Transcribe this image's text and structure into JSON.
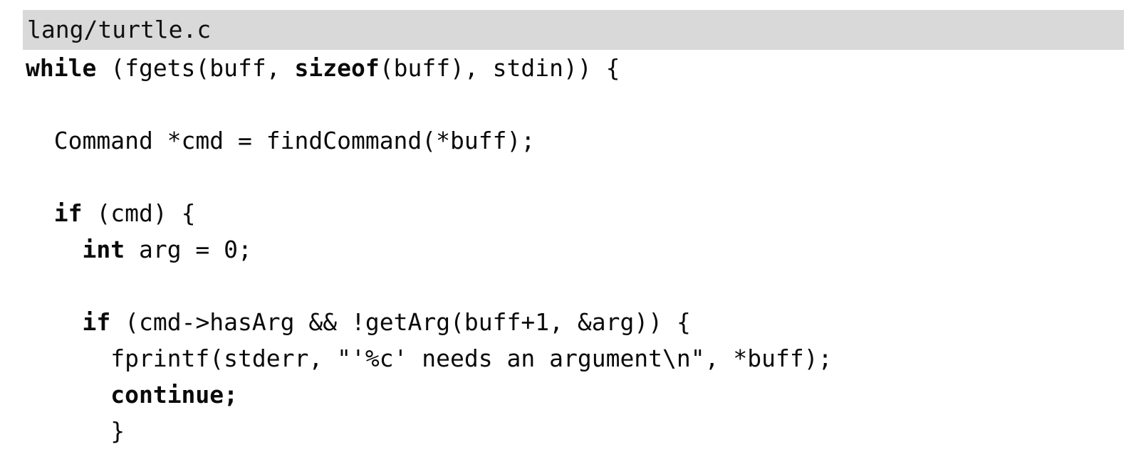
{
  "document": {
    "kind": "code-listing",
    "language": "c",
    "background_color": "#ffffff",
    "text_color": "#0a0a0a"
  },
  "file_header": {
    "name": "lang/turtle.c",
    "background_color": "#d9d9d9"
  },
  "code": {
    "lines": [
      {
        "index": 1,
        "blank": false,
        "text": "while (fgets(buff, sizeof(buff), stdin)) {",
        "tokens": [
          {
            "text": "while",
            "bold": true
          },
          {
            "text": " (fgets(buff, ",
            "bold": false
          },
          {
            "text": "sizeof",
            "bold": true
          },
          {
            "text": "(buff), stdin)) {",
            "bold": false
          }
        ]
      },
      {
        "index": 2,
        "blank": true,
        "text": " ",
        "tokens": [
          {
            "text": " ",
            "bold": false
          }
        ]
      },
      {
        "index": 3,
        "blank": false,
        "text": "  Command *cmd = findCommand(*buff);",
        "tokens": [
          {
            "text": "  Command *cmd = findCommand(*buff);",
            "bold": false
          }
        ]
      },
      {
        "index": 4,
        "blank": true,
        "text": " ",
        "tokens": [
          {
            "text": " ",
            "bold": false
          }
        ]
      },
      {
        "index": 5,
        "blank": false,
        "text": "  if (cmd) {",
        "tokens": [
          {
            "text": "  ",
            "bold": false
          },
          {
            "text": "if",
            "bold": true
          },
          {
            "text": " (cmd) {",
            "bold": false
          }
        ]
      },
      {
        "index": 6,
        "blank": false,
        "text": "    int arg = 0;",
        "tokens": [
          {
            "text": "    ",
            "bold": false
          },
          {
            "text": "int",
            "bold": true
          },
          {
            "text": " arg = 0;",
            "bold": false
          }
        ]
      },
      {
        "index": 7,
        "blank": true,
        "text": " ",
        "tokens": [
          {
            "text": " ",
            "bold": false
          }
        ]
      },
      {
        "index": 8,
        "blank": false,
        "text": "    if (cmd->hasArg && !getArg(buff+1, &arg)) {",
        "tokens": [
          {
            "text": "    ",
            "bold": false
          },
          {
            "text": "if",
            "bold": true
          },
          {
            "text": " (cmd->hasArg && !getArg(buff+1, &arg)) {",
            "bold": false
          }
        ]
      },
      {
        "index": 9,
        "blank": false,
        "text": "      fprintf(stderr, \"'%c' needs an argument\\n\", *buff);",
        "tokens": [
          {
            "text": "      fprintf(stderr, \"'%c' needs an argument\\n\", *buff);",
            "bold": false
          }
        ]
      },
      {
        "index": 10,
        "blank": false,
        "text": "      continue;",
        "tokens": [
          {
            "text": "      ",
            "bold": false
          },
          {
            "text": "continue;",
            "bold": true
          }
        ]
      },
      {
        "index": 11,
        "blank": false,
        "text": "      }",
        "tokens": [
          {
            "text": "      }",
            "bold": false
          }
        ]
      }
    ]
  }
}
